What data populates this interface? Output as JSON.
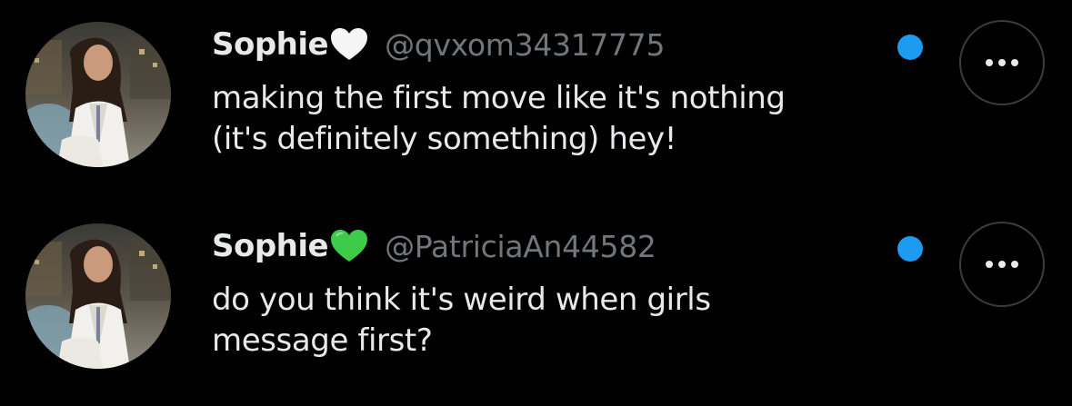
{
  "messages": [
    {
      "display_name": "Sophie",
      "heart_color": "#ffffff",
      "heart_icon": "white-heart-icon",
      "handle": "@qvxom34317775",
      "text_lines": [
        "making the first move like it's nothing",
        "(it's definitely something) hey!"
      ],
      "unread": true
    },
    {
      "display_name": "Sophie",
      "heart_color": "#3fcb4a",
      "heart_icon": "green-heart-icon",
      "handle": "@PatriciaAn44582",
      "text_lines": [
        "do you think it's weird when girls",
        "message first?"
      ],
      "unread": true
    }
  ],
  "colors": {
    "background": "#000000",
    "primary_text": "#e7e9ea",
    "secondary_text": "#71767b",
    "unread_dot": "#1d9bf0",
    "button_border": "#3a3d40"
  }
}
